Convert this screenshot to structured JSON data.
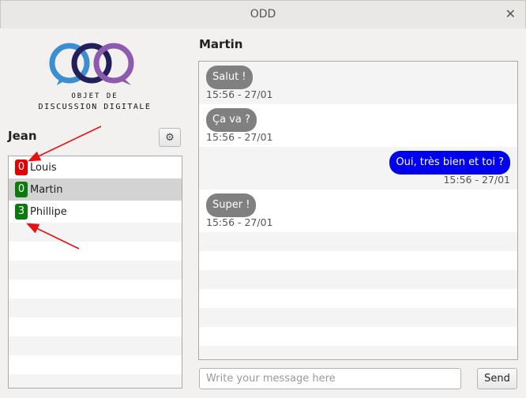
{
  "window": {
    "title": "ODD",
    "close_icon": "close-icon"
  },
  "logo": {
    "line1": "OBJET DE",
    "line2": "DISCUSSION DIGITALE"
  },
  "user": {
    "name": "Jean"
  },
  "settings": {
    "icon": "gear-icon"
  },
  "contacts": [
    {
      "name": "Louis",
      "unread": "0",
      "badge_color": "#e00000"
    },
    {
      "name": "Martin",
      "unread": "0",
      "badge_color": "#0a7a0a"
    },
    {
      "name": "Phillipe",
      "unread": "3",
      "badge_color": "#0a7a0a"
    }
  ],
  "chat": {
    "title": "Martin",
    "messages": [
      {
        "text": "Salut !",
        "time": "15:56 - 27/01",
        "direction": "in"
      },
      {
        "text": "Ça va ?",
        "time": "15:56 - 27/01",
        "direction": "in"
      },
      {
        "text": "Oui, très bien et toi ?",
        "time": "15:56 - 27/01",
        "direction": "out"
      },
      {
        "text": "Super !",
        "time": "15:56 - 27/01",
        "direction": "in"
      }
    ]
  },
  "composer": {
    "placeholder": "Write your message here",
    "send_label": "Send"
  },
  "colors": {
    "incoming_bubble": "#808080",
    "outgoing_bubble": "#0000ee",
    "annotation_arrow": "#e81010"
  }
}
